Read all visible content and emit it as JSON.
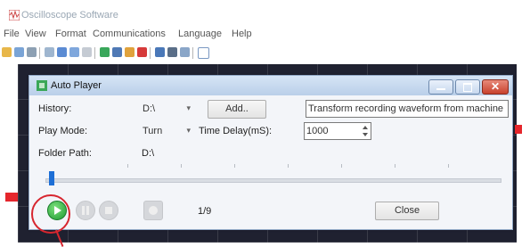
{
  "app": {
    "title": "Oscilloscope Software",
    "menu": [
      "File",
      "View",
      "Format",
      "Communications",
      "Language",
      "Help"
    ]
  },
  "dialog": {
    "title": "Auto Player",
    "history_label": "History:",
    "history_value": "D:\\",
    "add_button": "Add..",
    "transform_text": "Transform recording waveform from machine",
    "play_mode_label": "Play Mode:",
    "play_mode_value": "Turn",
    "time_delay_label": "Time Delay(mS):",
    "time_delay_value": "1000",
    "folder_path_label": "Folder Path:",
    "folder_path_value": "D:\\",
    "page_indicator": "1/9",
    "close_button": "Close"
  },
  "colors": {
    "accent": "#1e6fd6",
    "play_green": "#1f9a33",
    "highlight_red": "#d7262f",
    "scope_bg": "#1f2130"
  }
}
